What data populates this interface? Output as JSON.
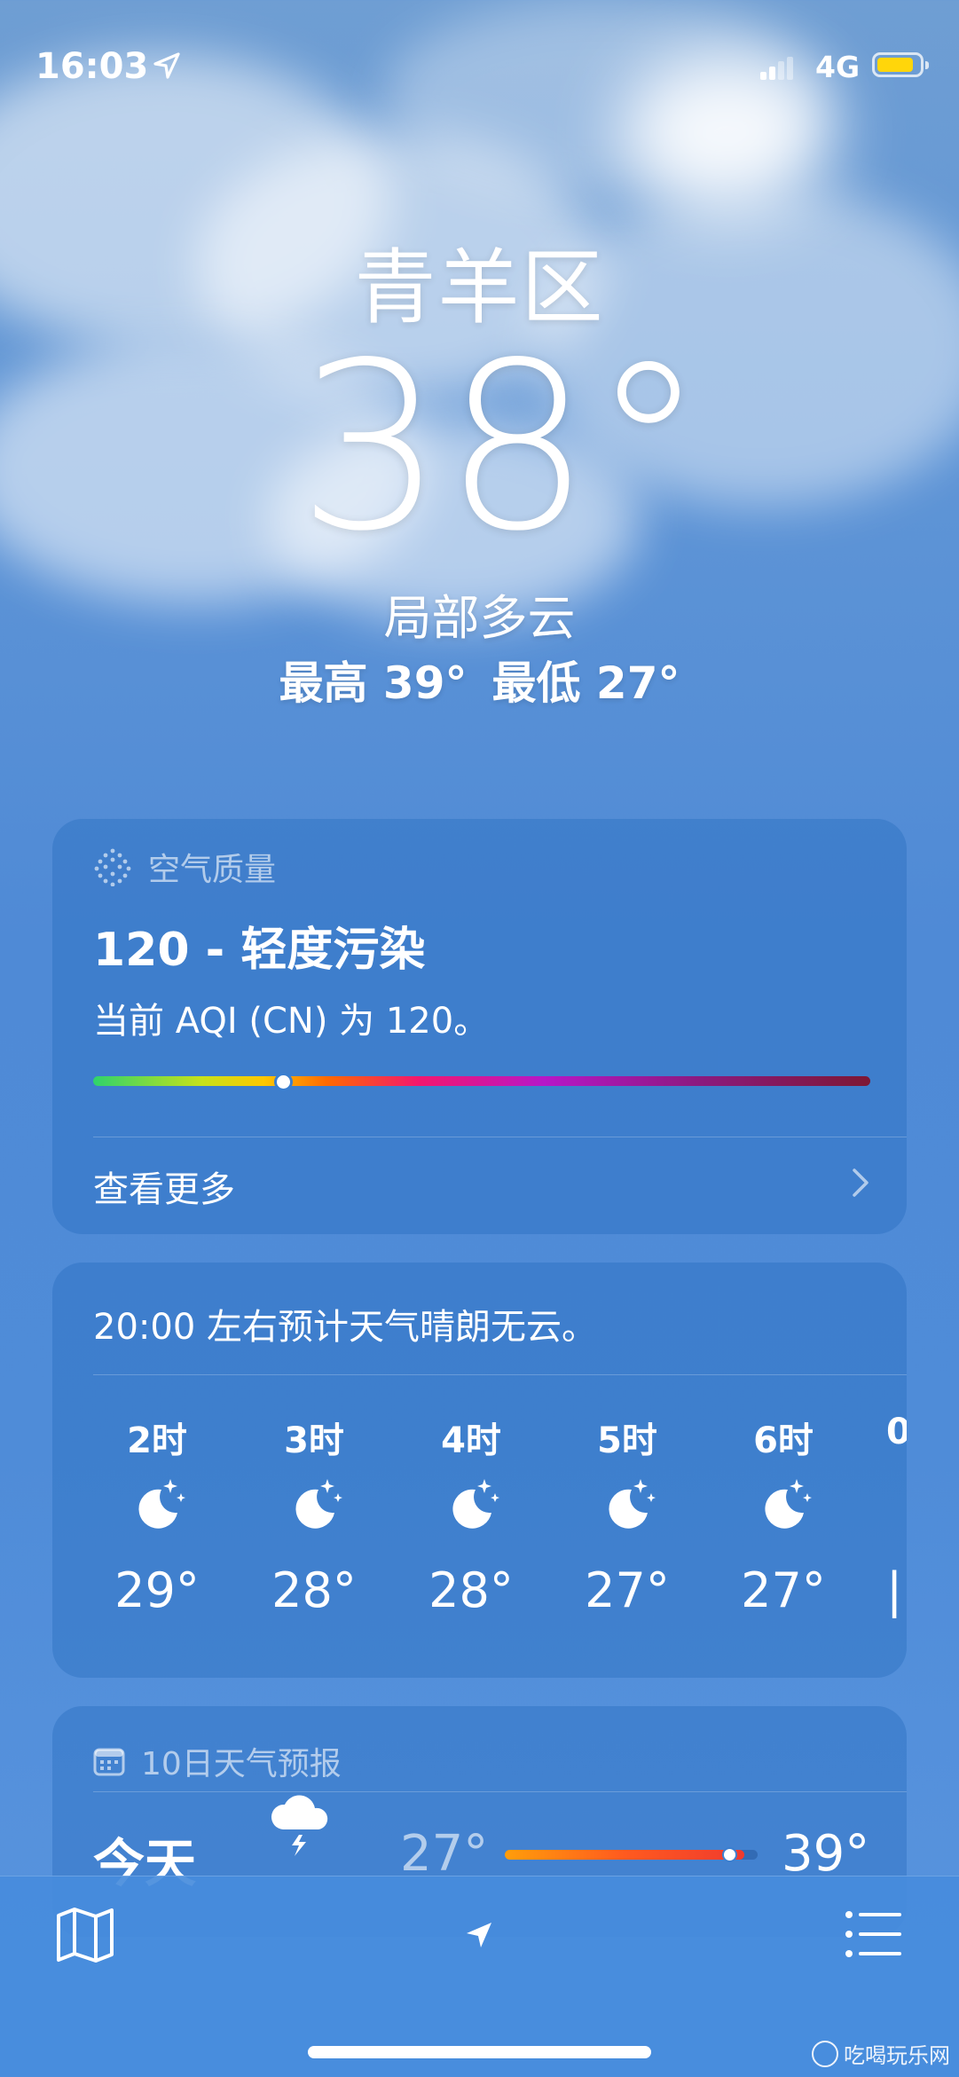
{
  "status_bar": {
    "time": "16:03",
    "network": "4G",
    "battery_color": "#ffd60a"
  },
  "header": {
    "city": "青羊区",
    "temperature": "38°",
    "condition": "局部多云",
    "high": "最高 39°",
    "low": "最低 27°"
  },
  "air_quality": {
    "heading": "空气质量",
    "title": "120 - 轻度污染",
    "description": "当前 AQI (CN) 为 120。",
    "aqi_value": 120,
    "scale_position_fraction": 0.243,
    "more_label": "查看更多"
  },
  "hourly": {
    "summary": "20:00 左右预计天气晴朗无云。",
    "items": [
      {
        "hour": "2时",
        "icon": "moon-stars-icon",
        "temp": "29°"
      },
      {
        "hour": "3时",
        "icon": "moon-stars-icon",
        "temp": "28°"
      },
      {
        "hour": "4时",
        "icon": "moon-stars-icon",
        "temp": "28°"
      },
      {
        "hour": "5时",
        "icon": "moon-stars-icon",
        "temp": "27°"
      },
      {
        "hour": "6时",
        "icon": "moon-stars-icon",
        "temp": "27°"
      },
      {
        "hour": "0",
        "icon": "moon-stars-icon",
        "temp": "|"
      }
    ]
  },
  "ten_day": {
    "heading": "10日天气预报",
    "rows": [
      {
        "day": "今天",
        "icon": "cloud-lightning-icon",
        "low": "27°",
        "high": "39°"
      }
    ]
  },
  "toolbar": {
    "map_icon": "map-icon",
    "location_icon": "location-arrow-icon",
    "list_icon": "list-icon"
  },
  "watermark": {
    "text": "吃喝玩乐网"
  }
}
